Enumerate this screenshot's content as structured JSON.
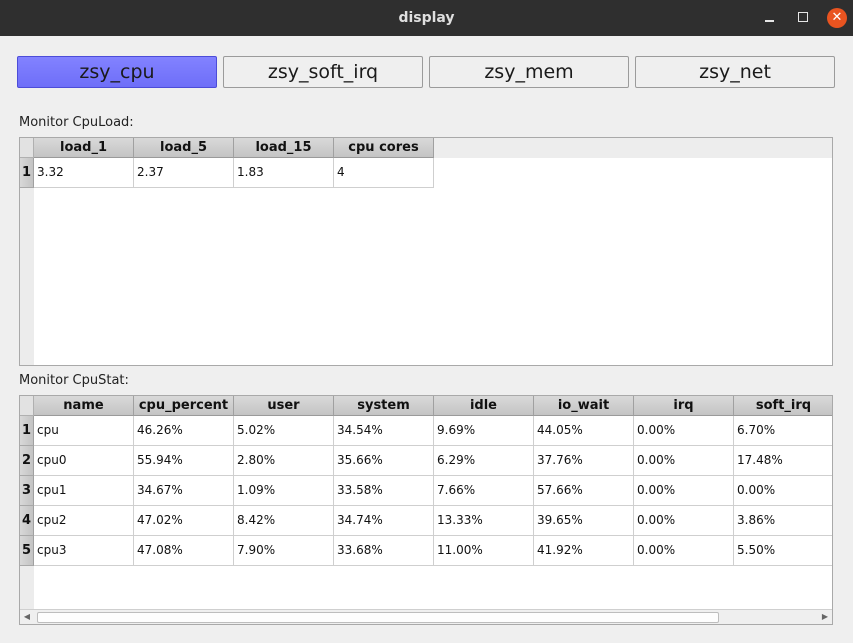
{
  "window": {
    "title": "display"
  },
  "tabs": [
    {
      "label": "zsy_cpu",
      "active": true
    },
    {
      "label": "zsy_soft_irq",
      "active": false
    },
    {
      "label": "zsy_mem",
      "active": false
    },
    {
      "label": "zsy_net",
      "active": false
    }
  ],
  "cpuload": {
    "label": "Monitor CpuLoad:",
    "columns": [
      "load_1",
      "load_5",
      "load_15",
      "cpu cores"
    ],
    "rows": [
      {
        "num": "1",
        "cells": [
          "3.32",
          "2.37",
          "1.83",
          "4"
        ]
      }
    ]
  },
  "cpustat": {
    "label": "Monitor CpuStat:",
    "columns": [
      "name",
      "cpu_percent",
      "user",
      "system",
      "idle",
      "io_wait",
      "irq",
      "soft_irq"
    ],
    "rows": [
      {
        "num": "1",
        "cells": [
          "cpu",
          "46.26%",
          "5.02%",
          "34.54%",
          "9.69%",
          "44.05%",
          "0.00%",
          "6.70%"
        ]
      },
      {
        "num": "2",
        "cells": [
          "cpu0",
          "55.94%",
          "2.80%",
          "35.66%",
          "6.29%",
          "37.76%",
          "0.00%",
          "17.48%"
        ]
      },
      {
        "num": "3",
        "cells": [
          "cpu1",
          "34.67%",
          "1.09%",
          "33.58%",
          "7.66%",
          "57.66%",
          "0.00%",
          "0.00%"
        ]
      },
      {
        "num": "4",
        "cells": [
          "cpu2",
          "47.02%",
          "8.42%",
          "34.74%",
          "13.33%",
          "39.65%",
          "0.00%",
          "3.86%"
        ]
      },
      {
        "num": "5",
        "cells": [
          "cpu3",
          "47.08%",
          "7.90%",
          "33.68%",
          "11.00%",
          "41.92%",
          "0.00%",
          "5.50%"
        ]
      }
    ]
  },
  "colors": {
    "active_tab": "#7777ff",
    "close_button": "#e95420",
    "titlebar": "#2f2f2f"
  },
  "icons": {
    "minimize": "minimize-icon",
    "maximize": "maximize-icon",
    "close": "close-icon"
  }
}
